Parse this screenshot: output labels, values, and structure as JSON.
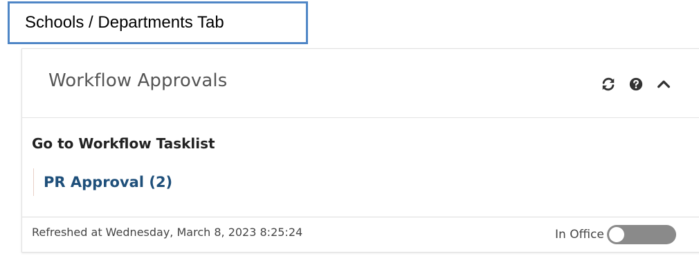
{
  "callout": {
    "label": "Schools / Departments Tab",
    "border_color": "#4f86c6"
  },
  "widget": {
    "title": "Workflow Approvals",
    "header_icons": [
      "refresh-icon",
      "help-icon",
      "chevron-up-icon"
    ],
    "tasklist_link": "Go to Workflow Tasklist",
    "approval_link": "PR Approval (2)",
    "link_color": "#1e4f7a"
  },
  "footer": {
    "refreshed_text": "Refreshed at Wednesday, March 8, 2023 8:25:24",
    "in_office_label": "In Office",
    "in_office_enabled": false
  }
}
